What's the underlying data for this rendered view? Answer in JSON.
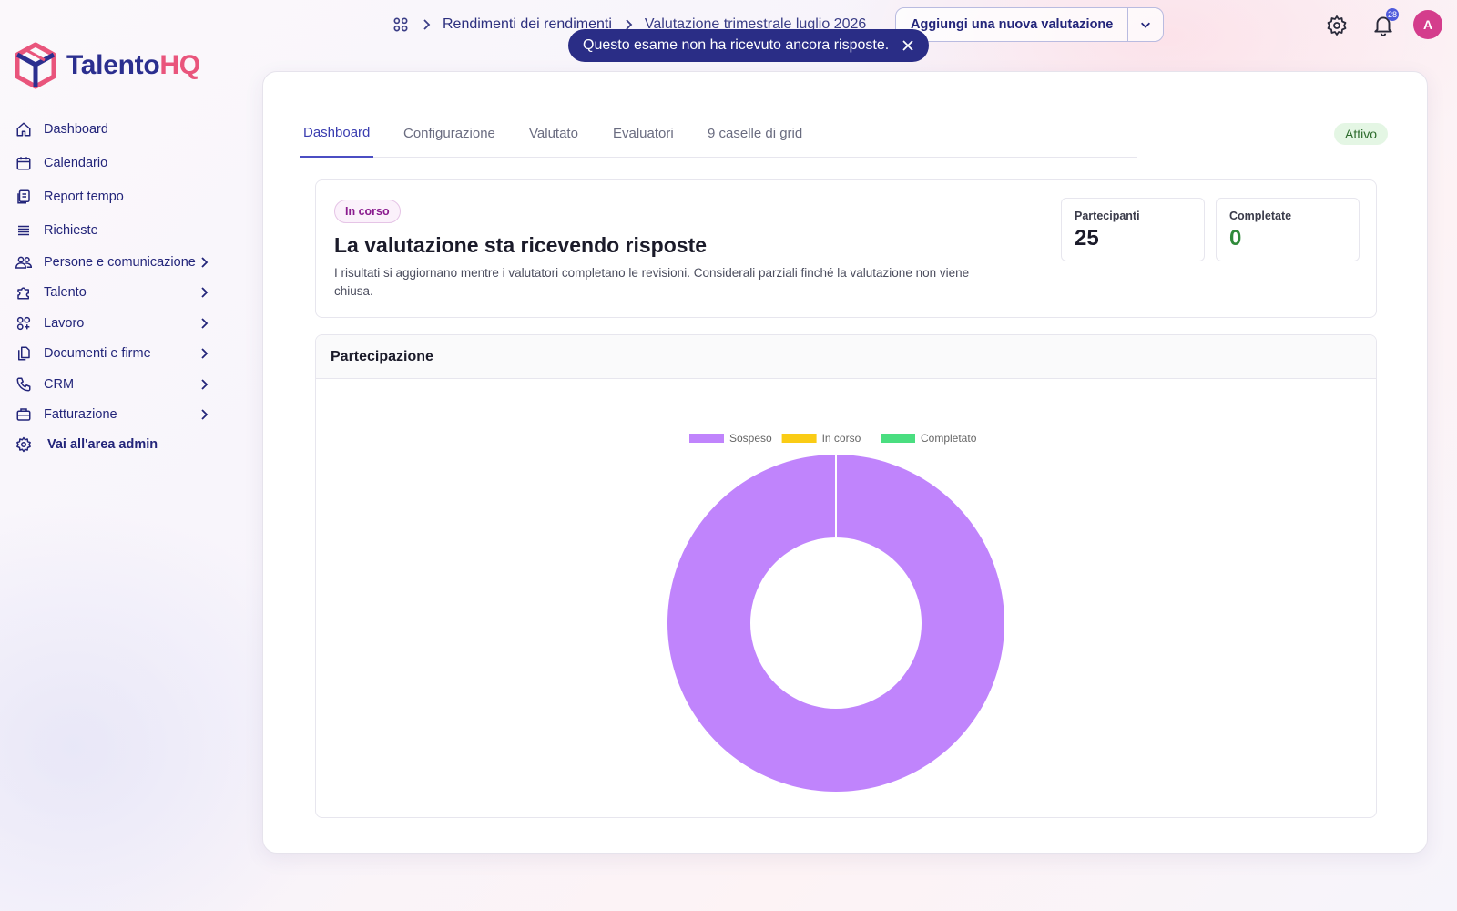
{
  "brand": {
    "name_part1": "Talento",
    "name_part2": "HQ",
    "primary": "#2b2f8f",
    "accent": "#e9557c"
  },
  "sidebar": {
    "items": [
      {
        "label": "Dashboard",
        "icon": "home-icon",
        "chevron": false
      },
      {
        "label": "Calendario",
        "icon": "calendar-icon",
        "chevron": false
      },
      {
        "label": "Report tempo",
        "icon": "report-icon",
        "chevron": false
      },
      {
        "label": "Richieste",
        "icon": "list-icon",
        "chevron": false
      },
      {
        "label": "Persone e comunicazione",
        "icon": "people-icon",
        "chevron": true
      },
      {
        "label": "Talento",
        "icon": "puzzle-icon",
        "chevron": true
      },
      {
        "label": "Lavoro",
        "icon": "apps-icon",
        "chevron": true
      },
      {
        "label": "Documenti e firme",
        "icon": "documents-icon",
        "chevron": true
      },
      {
        "label": "CRM",
        "icon": "phone-icon",
        "chevron": true
      },
      {
        "label": "Fatturazione",
        "icon": "briefcase-icon",
        "chevron": true
      },
      {
        "label": "Vai all'area admin",
        "icon": "gear-icon",
        "chevron": false
      }
    ]
  },
  "header": {
    "breadcrumb": [
      "Rendimenti dei rendimenti",
      "Valutazione trimestrale luglio 2026"
    ],
    "add_button": "Aggiungi una nuova valutazione",
    "notification_count": "28",
    "avatar_initial": "A"
  },
  "toast": {
    "message": "Questo esame non ha ricevuto ancora risposte."
  },
  "tabs": [
    "Dashboard",
    "Configurazione",
    "Valutato",
    "Evaluatori",
    "9 caselle di grid"
  ],
  "active_tab": 0,
  "status": "Attivo",
  "info": {
    "badge": "In corso",
    "title": "La valutazione sta ricevendo risposte",
    "description": "I risultati si aggiornano mentre i valutatori completano le revisioni. Considerali parziali finché la valutazione non viene chiusa.",
    "stats": [
      {
        "label": "Partecipanti",
        "value": "25",
        "color": "#1b1b2a"
      },
      {
        "label": "Completate",
        "value": "0",
        "color": "#2f8a3a"
      }
    ]
  },
  "chart_panel": {
    "title": "Partecipazione"
  },
  "chart_data": {
    "type": "pie",
    "variant": "doughnut",
    "legend_position": "top",
    "series": [
      {
        "name": "Sospeso",
        "value": 25,
        "color": "#c084fc"
      },
      {
        "name": "In corso",
        "value": 0,
        "color": "#facc15"
      },
      {
        "name": "Completato",
        "value": 0,
        "color": "#4ade80"
      }
    ]
  }
}
